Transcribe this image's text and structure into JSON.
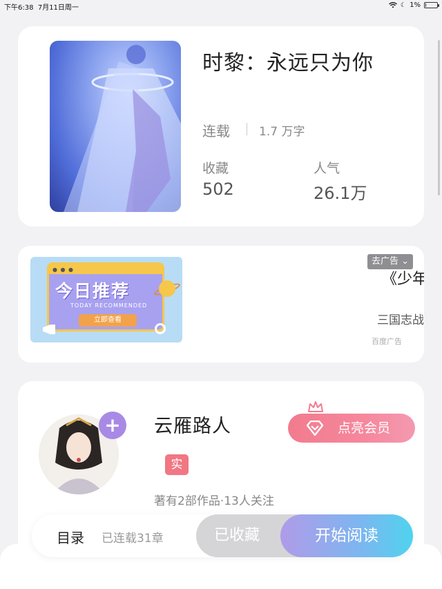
{
  "status_bar": {
    "time": "下午6:38",
    "date": "7月11日周一",
    "battery": "1%",
    "battery_level": 0.01
  },
  "book": {
    "title": "时黎：永远只为你",
    "status": "连载",
    "word_count": "1.7 万字",
    "favorites_label": "收藏",
    "favorites_value": "502",
    "popularity_label": "人气",
    "popularity_value": "26.1万"
  },
  "ad": {
    "banner_title": "今日推荐",
    "banner_subtitle": "TODAY RECOMMENDED",
    "banner_cta": "立即查看",
    "close_tag": "去广告",
    "title": "《少年三",
    "description": "三国志战略版",
    "source": "百度广告"
  },
  "author": {
    "name": "云雁路人",
    "verified_badge": "实",
    "meta": "著有2部作品·13人关注",
    "follow_symbol": "+",
    "vip_button": "点亮会员"
  },
  "bottom_bar": {
    "toc": "目录",
    "chapters": "已连载31章",
    "collected": "已收藏",
    "start_reading": "开始阅读"
  }
}
